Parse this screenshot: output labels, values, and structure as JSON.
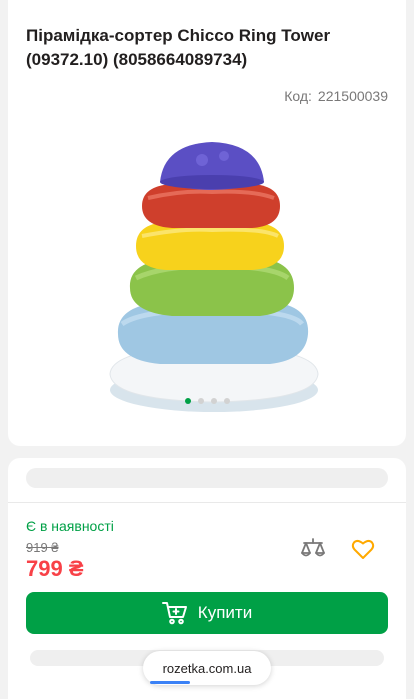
{
  "product": {
    "title": "Пірамідка-сортер Chicco Ring Tower (09372.10) (8058664089734)",
    "code_label": "Код:",
    "code_value": "221500039",
    "image_icon": "stacking-rings-toy",
    "gallery": {
      "count": 4,
      "active_index": 0
    }
  },
  "purchase": {
    "availability": "Є в наявності",
    "old_price": "919 ₴",
    "price": "799 ₴",
    "compare_icon": "scales-icon",
    "wishlist_icon": "heart-icon",
    "buy_label": "Купити",
    "buy_icon": "cart-icon"
  },
  "browser": {
    "url": "rozetka.com.ua"
  },
  "colors": {
    "accent_green": "#00a046",
    "price_red": "#f84147",
    "wishlist_orange": "#ffa900",
    "compare_gray": "#797878"
  }
}
